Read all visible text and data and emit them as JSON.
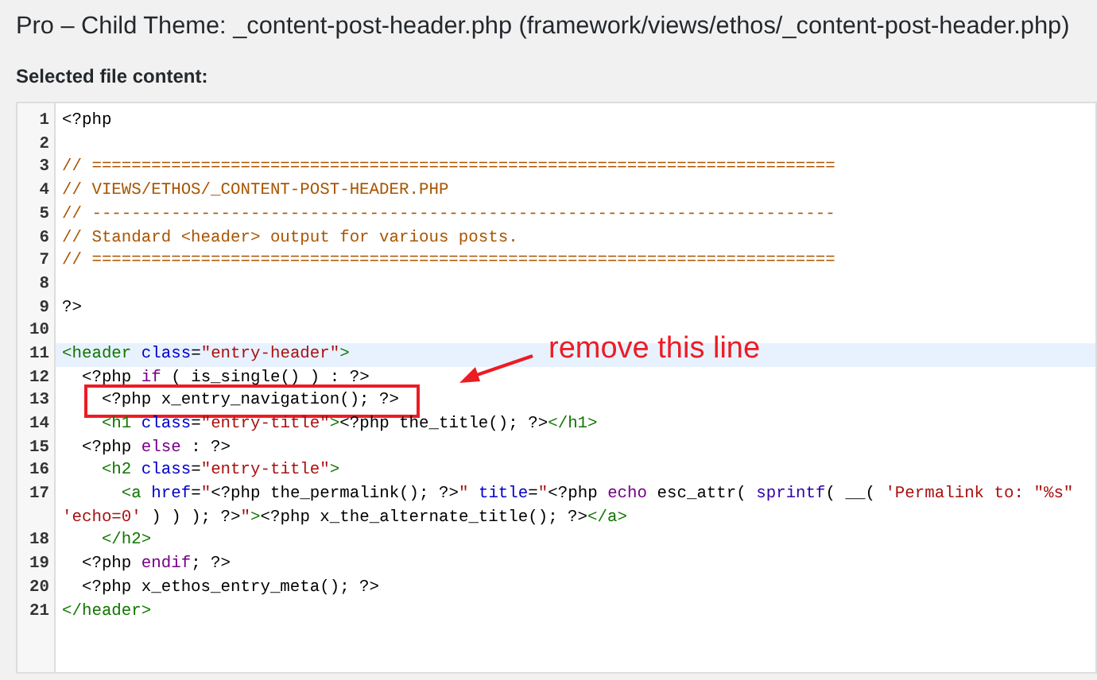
{
  "page_title": "Pro – Child Theme: _content-post-header.php (framework/views/ethos/_content-post-header.php)",
  "section_label": "Selected file content:",
  "editor": {
    "lines": [
      {
        "number": "1",
        "selected": false,
        "tokens": [
          {
            "kind": "plain",
            "text": "<?php"
          }
        ]
      },
      {
        "number": "2",
        "selected": false
      },
      {
        "number": "3",
        "selected": false,
        "tokens": [
          {
            "kind": "comment",
            "text": "// ==========================================================================="
          }
        ]
      },
      {
        "number": "4",
        "selected": false,
        "tokens": [
          {
            "kind": "comment",
            "text": "// VIEWS/ETHOS/_CONTENT-POST-HEADER.PHP"
          }
        ]
      },
      {
        "number": "5",
        "selected": false,
        "tokens": [
          {
            "kind": "comment",
            "text": "// ---------------------------------------------------------------------------"
          }
        ]
      },
      {
        "number": "6",
        "selected": false,
        "tokens": [
          {
            "kind": "comment",
            "text": "// Standard <header> output for various posts."
          }
        ]
      },
      {
        "number": "7",
        "selected": false,
        "tokens": [
          {
            "kind": "comment",
            "text": "// ==========================================================================="
          }
        ]
      },
      {
        "number": "8",
        "selected": false
      },
      {
        "number": "9",
        "selected": false,
        "tokens": [
          {
            "kind": "plain",
            "text": "?>"
          }
        ]
      },
      {
        "number": "10",
        "selected": false
      },
      {
        "number": "11",
        "selected": true,
        "tokens": [
          {
            "kind": "tag",
            "text": "<header"
          },
          {
            "kind": "attribute",
            "text": " class"
          },
          {
            "kind": "plain",
            "text": "="
          },
          {
            "kind": "string",
            "text": "\"entry-header\""
          },
          {
            "kind": "tag",
            "text": ">"
          }
        ]
      },
      {
        "number": "12",
        "selected": false,
        "tokens": [
          {
            "kind": "plain",
            "text": "  <?php "
          },
          {
            "kind": "keyword",
            "text": "if"
          },
          {
            "kind": "plain",
            "text": " ( is_single() ) : ?>"
          }
        ]
      },
      {
        "number": "13",
        "selected": false,
        "boxed": true,
        "tokens": [
          {
            "kind": "plain",
            "text": "    <?php x_entry_navigation(); ?>"
          }
        ]
      },
      {
        "number": "14",
        "selected": false,
        "tokens": [
          {
            "kind": "tag",
            "text": "    <h1"
          },
          {
            "kind": "attribute",
            "text": " class"
          },
          {
            "kind": "plain",
            "text": "="
          },
          {
            "kind": "string",
            "text": "\"entry-title\""
          },
          {
            "kind": "tag",
            "text": ">"
          },
          {
            "kind": "plain",
            "text": "<?php the_title(); ?>"
          },
          {
            "kind": "tag",
            "text": "</h1>"
          }
        ]
      },
      {
        "number": "15",
        "selected": false,
        "tokens": [
          {
            "kind": "plain",
            "text": "  <?php "
          },
          {
            "kind": "keyword",
            "text": "else"
          },
          {
            "kind": "plain",
            "text": " : ?>"
          }
        ]
      },
      {
        "number": "16",
        "selected": false,
        "tokens": [
          {
            "kind": "tag",
            "text": "    <h2"
          },
          {
            "kind": "attribute",
            "text": " class"
          },
          {
            "kind": "plain",
            "text": "="
          },
          {
            "kind": "string",
            "text": "\"entry-title\""
          },
          {
            "kind": "tag",
            "text": ">"
          }
        ]
      },
      {
        "number": "17",
        "selected": false,
        "tokens": [
          {
            "kind": "tag",
            "text": "      <a"
          },
          {
            "kind": "attribute",
            "text": " href"
          },
          {
            "kind": "plain",
            "text": "="
          },
          {
            "kind": "string",
            "text": "\""
          },
          {
            "kind": "plain",
            "text": "<?php the_permalink(); ?>"
          },
          {
            "kind": "string",
            "text": "\""
          },
          {
            "kind": "attribute",
            "text": " title"
          },
          {
            "kind": "plain",
            "text": "="
          },
          {
            "kind": "string",
            "text": "\""
          },
          {
            "kind": "plain",
            "text": "<?php "
          },
          {
            "kind": "keyword",
            "text": "echo"
          },
          {
            "kind": "plain",
            "text": " esc_attr( "
          },
          {
            "kind": "builtin",
            "text": "sprintf"
          },
          {
            "kind": "plain",
            "text": "( __( "
          },
          {
            "kind": "string",
            "text": "'Permalink to: \"%s\""
          }
        ],
        "continuation": [
          {
            "kind": "string",
            "text": "'echo=0'"
          },
          {
            "kind": "plain",
            "text": " ) ) ); ?>"
          },
          {
            "kind": "string",
            "text": "\""
          },
          {
            "kind": "tag",
            "text": ">"
          },
          {
            "kind": "plain",
            "text": "<?php x_the_alternate_title(); ?>"
          },
          {
            "kind": "tag",
            "text": "</a>"
          }
        ]
      },
      {
        "number": "18",
        "selected": false,
        "tokens": [
          {
            "kind": "tag",
            "text": "    </h2>"
          }
        ]
      },
      {
        "number": "19",
        "selected": false,
        "tokens": [
          {
            "kind": "plain",
            "text": "  <?php "
          },
          {
            "kind": "keyword",
            "text": "endif"
          },
          {
            "kind": "plain",
            "text": "; ?>"
          }
        ]
      },
      {
        "number": "20",
        "selected": false,
        "tokens": [
          {
            "kind": "plain",
            "text": "  <?php x_ethos_entry_meta(); ?>"
          }
        ]
      },
      {
        "number": "21",
        "selected": false,
        "tokens": [
          {
            "kind": "tag",
            "text": "</header>"
          }
        ]
      }
    ]
  },
  "annotation": {
    "text": "remove this line"
  }
}
